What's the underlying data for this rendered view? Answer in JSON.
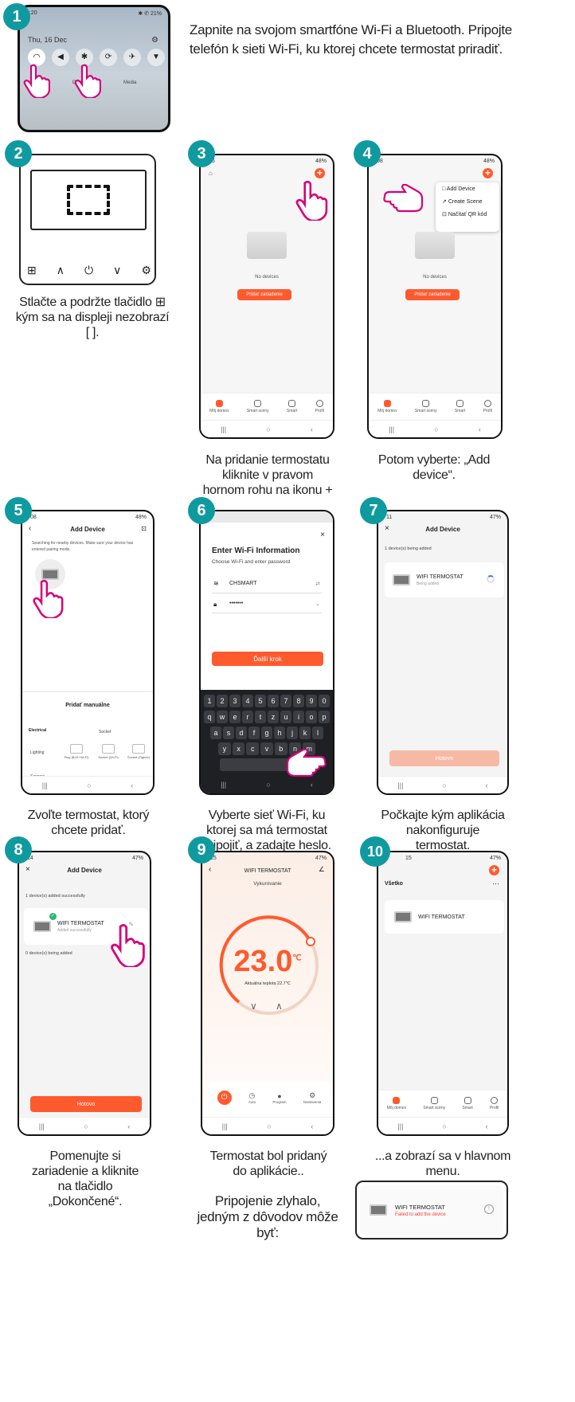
{
  "steps": {
    "s1": "1",
    "s2": "2",
    "s3": "3",
    "s4": "4",
    "s5": "5",
    "s6": "6",
    "s7": "7",
    "s8": "8",
    "s9": "9",
    "s10": "10"
  },
  "captions": {
    "c1": "Zapnite na svojom smartfóne Wi-Fi a Bluetooth. Pripojte telefón k sieti Wi-Fi, ku ktorej chcete termostat priradiť.",
    "c2": "Stlačte a podržte tlačidlo ⊞ kým sa na displeji nezobrazí [ ].",
    "c3": "Na pridanie termostatu kliknite v pravom hornom rohu na ikonu +",
    "c4": "Potom vyberte: „Add device“.",
    "c5": "Zvoľte termostat, ktorý chcete pridať.",
    "c6": "Vyberte sieť Wi-Fi, ku ktorej sa má termostat pripojiť, a zadajte heslo.",
    "c7": "Počkajte kým aplikácia nakonfiguruje termostat.",
    "c8": "Pomenujte si zariadenie a kliknite na tlačidlo „Dokončené“.",
    "c9": "Termostat bol pridaný do aplikácie..",
    "c10": "...a zobrazí sa v hlavnom menu.",
    "c11": "Pripojenie zlyhalo, jedným z dôvodov môže byť:"
  },
  "s1": {
    "time": "2:20",
    "date": "Thu, 16 Dec",
    "devices": "Devices",
    "media": "Media",
    "status": "✱ ✆ 21%"
  },
  "home": {
    "no_devices": "No devices",
    "add": "Pridať zariadenie",
    "tabs": [
      "Môj domov",
      "Smart scény",
      "Smart",
      "Profil"
    ],
    "time3": "06",
    "time4": "08",
    "battery": "48%"
  },
  "menu4": [
    "Add Device",
    "Create Scene",
    "Načítať QR kód"
  ],
  "s5": {
    "title": "Add Device",
    "time": "08",
    "battery": "48%",
    "search": "Searching for nearby devices. Make sure your device has entered pairing mode.",
    "manual": "Pridať manuálne",
    "electrical": "Electrical",
    "lighting": "Lighting",
    "sensors": "Sensors",
    "socket": "Socket",
    "items": [
      "Plug (BLE+Wi-Fi)",
      "Socket (Wi-Fi)",
      "Socket (Zigbee)"
    ]
  },
  "s6": {
    "title": "Enter Wi-Fi Information",
    "sub": "Choose Wi-Fi and enter password",
    "ssid": "CHSMART",
    "pwd": "•••••••",
    "next": "Ďalší krok",
    "row1": [
      "1",
      "2",
      "3",
      "4",
      "5",
      "6",
      "7",
      "8",
      "9",
      "0"
    ],
    "row2": [
      "q",
      "w",
      "e",
      "r",
      "t",
      "z",
      "u",
      "i",
      "o",
      "p"
    ],
    "row3": [
      "a",
      "s",
      "d",
      "f",
      "g",
      "h",
      "j",
      "k",
      "l"
    ],
    "row4": [
      "y",
      "x",
      "c",
      "v",
      "b",
      "n",
      "m"
    ]
  },
  "s7": {
    "title": "Add Device",
    "time": "11",
    "battery": "47%",
    "count": "1 device(s) being added",
    "device": "WIFI TERMOSTAT",
    "state": "Being added",
    "done": "Hotovo"
  },
  "s8": {
    "title": "Add Device",
    "time": "14",
    "battery": "47%",
    "count": "1 device(s) added successfully",
    "device": "WIFI TERMOSTAT",
    "state": "Added successfully",
    "adding": "0 device(s) being added",
    "done": "Hotovo"
  },
  "s9": {
    "title": "WIFI TERMOSTAT",
    "mode": "Vykurovanie",
    "temp": "23.0",
    "unit": "℃",
    "current": "Aktuálna teplota 22.7℃",
    "time": "15",
    "battery": "47%",
    "buttons": [
      "Auto",
      "Program",
      "Nastavenia"
    ]
  },
  "s10": {
    "all": "Všetko",
    "device": "WIFI TERMOSTAT",
    "time": "15",
    "battery": "47%",
    "tabs": [
      "Môj domov",
      "Smart scény",
      "Smart",
      "Profil"
    ]
  },
  "fail": {
    "device": "WIFI TERMOSTAT",
    "msg": "Failed to add the device"
  }
}
